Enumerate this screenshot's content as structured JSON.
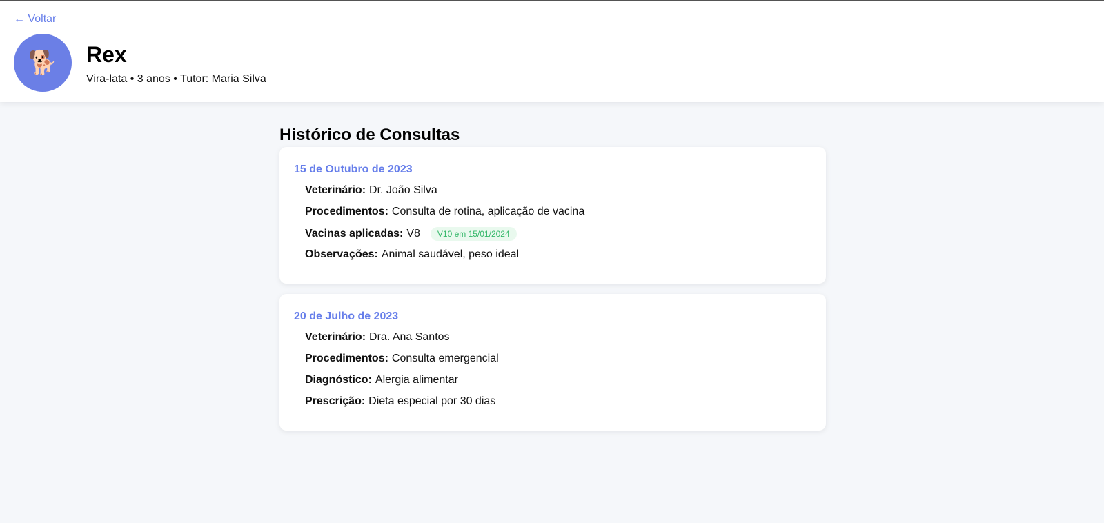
{
  "header": {
    "back_label": "← Voltar",
    "avatar_icon": "dog-icon",
    "avatar_glyph": "🐕",
    "pet_name": "Rex",
    "pet_meta": "Vira-lata • 3 anos • Tutor: Maria Silva"
  },
  "main": {
    "section_title": "Histórico de Consultas",
    "consultations": [
      {
        "date": "15 de Outubro de 2023",
        "fields": [
          {
            "label": "Veterinário:",
            "value": "Dr. João Silva"
          },
          {
            "label": "Procedimentos:",
            "value": "Consulta de rotina, aplicação de vacina"
          },
          {
            "label": "Vacinas aplicadas:",
            "value": "V8",
            "badge": "V10 em 15/01/2024"
          },
          {
            "label": "Observações:",
            "value": "Animal saudável, peso ideal"
          }
        ]
      },
      {
        "date": "20 de Julho de 2023",
        "fields": [
          {
            "label": "Veterinário:",
            "value": "Dra. Ana Santos"
          },
          {
            "label": "Procedimentos:",
            "value": "Consulta emergencial"
          },
          {
            "label": "Diagnóstico:",
            "value": "Alergia alimentar"
          },
          {
            "label": "Prescrição:",
            "value": "Dieta especial por 30 dias"
          }
        ]
      }
    ]
  },
  "colors": {
    "accent": "#667eea",
    "avatar_bg": "#6b7fe6",
    "badge_bg": "#e9f9ee",
    "badge_text": "#35b86a",
    "page_bg": "#f5f7fa"
  }
}
